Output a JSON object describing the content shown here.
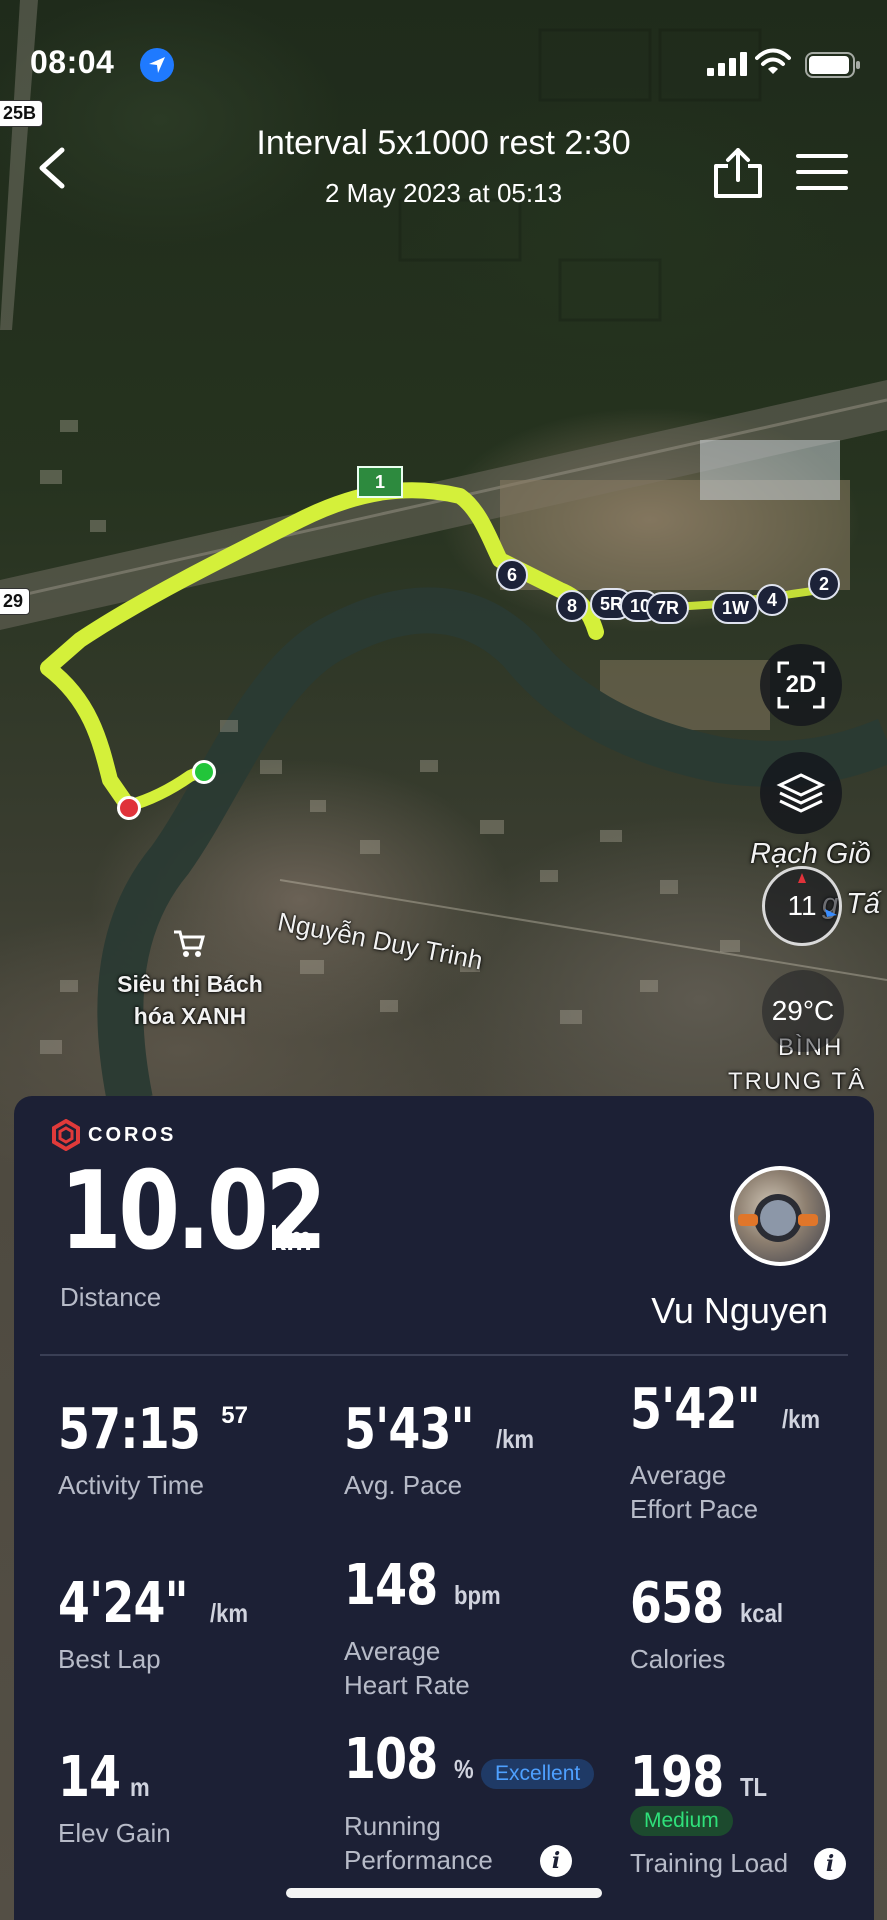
{
  "status_bar": {
    "time": "08:04"
  },
  "nav": {
    "title": "Interval 5x1000 rest 2:30",
    "subtitle": "2 May 2023 at 05:13"
  },
  "map": {
    "road_shields": [
      "25B",
      "29"
    ],
    "km_marker": "1",
    "lap_markers": [
      "6",
      "8",
      "5R",
      "10",
      "7R",
      "1W",
      "4",
      "2"
    ],
    "view_mode": "2D",
    "compass_value": "11",
    "weather": "29°C",
    "labels": {
      "street": "Nguyễn Duy Trinh",
      "store_line1": "Siêu thị Bách",
      "store_line2": "hóa XANH",
      "area1": "Rạch Giồ",
      "area2": "g Tấ",
      "area3": "BÌNH",
      "area4": "TRUNG TÂ"
    },
    "colors": {
      "route": "#d4f03a",
      "start": "#22c53a",
      "end": "#e0323a"
    }
  },
  "panel": {
    "brand": "COROS",
    "distance": {
      "value": "10.02",
      "unit": "km",
      "label": "Distance"
    },
    "user_name": "Vu Nguyen",
    "stats": {
      "activity_time": {
        "value": "57:15",
        "sup": "57",
        "label": "Activity Time"
      },
      "avg_pace": {
        "value": "5'43\"",
        "unit": "/km",
        "label": "Avg. Pace"
      },
      "effort_pace": {
        "value": "5'42\"",
        "unit": "/km",
        "label_line1": "Average",
        "label_line2": "Effort Pace"
      },
      "best_lap": {
        "value": "4'24\"",
        "unit": "/km",
        "label": "Best Lap"
      },
      "heart_rate": {
        "value": "148",
        "unit": "bpm",
        "label_line1": "Average",
        "label_line2": "Heart Rate"
      },
      "calories": {
        "value": "658",
        "unit": "kcal",
        "label": "Calories"
      },
      "elev_gain": {
        "value": "14",
        "unit": "m",
        "label": "Elev Gain"
      },
      "running_performance": {
        "value": "108",
        "unit": "%",
        "badge": "Excellent",
        "label_line1": "Running",
        "label_line2": "Performance"
      },
      "training_load": {
        "value": "198",
        "unit": "TL",
        "badge": "Medium",
        "label": "Training Load"
      }
    },
    "colors": {
      "background": "#1c2035",
      "excellent": "#4ea0ff",
      "medium": "#2fe07a",
      "brand": "#e03a3a"
    }
  }
}
